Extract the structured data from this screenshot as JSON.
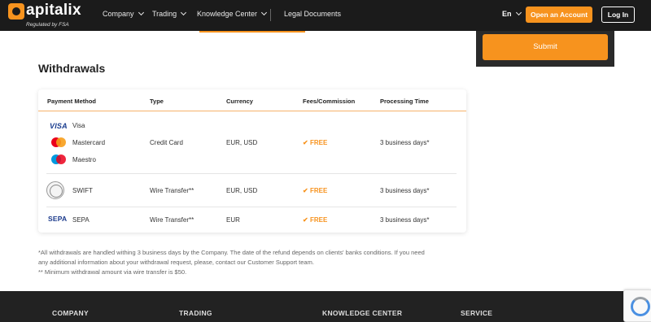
{
  "header": {
    "logo_text": "apitalix",
    "logo_sub": "Regulated by FSA",
    "nav": [
      {
        "label": "Company"
      },
      {
        "label": "Trading"
      },
      {
        "label": "Knowledge Center"
      },
      {
        "label": "Legal Documents"
      }
    ],
    "lang": "En",
    "open_account": "Open an Account",
    "login": "Log In"
  },
  "form": {
    "submit": "Submit"
  },
  "withdrawals": {
    "title": "Withdrawals",
    "columns": [
      "Payment Method",
      "Type",
      "Currency",
      "Fees/Commission",
      "Processing Time"
    ],
    "rows": [
      {
        "methods": [
          {
            "icon": "visa-icon",
            "label": "Visa",
            "logo_text": "VISA"
          },
          {
            "icon": "mastercard-icon",
            "label": "Mastercard"
          },
          {
            "icon": "maestro-icon",
            "label": "Maestro"
          }
        ],
        "type": "Credit Card",
        "currency": "EUR, USD",
        "fees": "FREE",
        "time": "3 business days*"
      },
      {
        "methods": [
          {
            "icon": "swift-icon",
            "label": "SWIFT"
          }
        ],
        "type": "Wire Transfer**",
        "currency": "EUR, USD",
        "fees": "FREE",
        "time": "3 business days*"
      },
      {
        "methods": [
          {
            "icon": "sepa-icon",
            "label": "SEPA",
            "logo_text": "SEPA"
          }
        ],
        "type": "Wire Transfer**",
        "currency": "EUR",
        "fees": "FREE",
        "time": "3 business days*"
      }
    ],
    "check_mark": "✔",
    "notes": [
      "*All withdrawals are handled withing 3 business days by the Company. The date of the refund depends on clients' banks conditions. If you need",
      "any additional information about your withdrawal request, please, contact our Customer Support team.",
      "** Minimum withdrawal amount via wire transfer is $50."
    ]
  },
  "footer": {
    "columns": [
      "COMPANY",
      "TRADING",
      "KNOWLEDGE CENTER",
      "SERVICE"
    ]
  },
  "colors": {
    "accent": "#f7931e",
    "header_bg": "#1b1b1b",
    "footer_bg": "#222222"
  }
}
